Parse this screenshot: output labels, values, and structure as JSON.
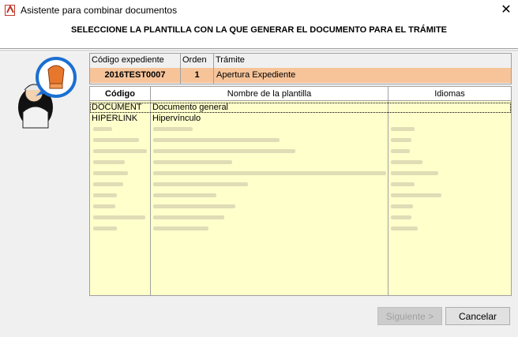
{
  "window": {
    "title": "Asistente para combinar documentos",
    "heading": "SELECCIONE LA PLANTILLA CON LA QUE GENERAR EL DOCUMENTO PARA EL TRÁMITE",
    "close_glyph": "✕"
  },
  "expediente": {
    "headers": {
      "codigo": "Código expediente",
      "orden": "Orden",
      "tramite": "Trámite"
    },
    "values": {
      "codigo": "2016TEST0007",
      "orden": "1",
      "tramite": "Apertura Expediente"
    }
  },
  "templates": {
    "headers": {
      "codigo": "Código",
      "nombre": "Nombre de la plantilla",
      "idiomas": "Idiomas"
    },
    "rows": [
      {
        "codigo": "DOCUMENT",
        "nombre": "Documento general",
        "idiomas": ""
      },
      {
        "codigo": "HIPERLINK",
        "nombre": "Hipervínculo",
        "idiomas": ""
      }
    ]
  },
  "buttons": {
    "next": "Siguiente >",
    "cancel": "Cancelar"
  },
  "colors": {
    "info_bg": "#f7c49a",
    "grid_bg": "#ffffcc"
  }
}
